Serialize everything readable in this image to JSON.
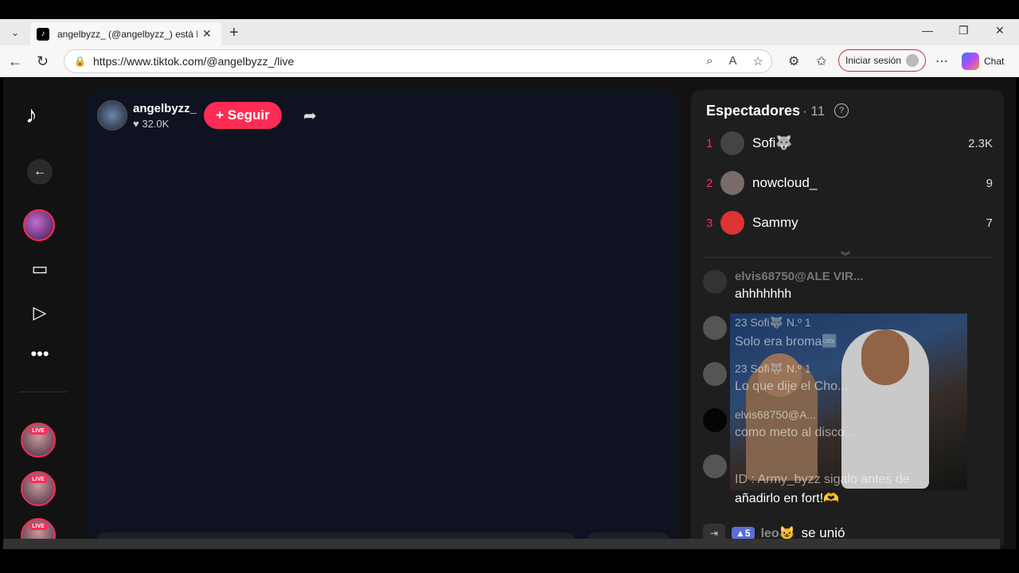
{
  "browser": {
    "tab_title": "angelbyzz_ (@angelbyzz_) está LIVE",
    "url": "https://www.tiktok.com/@angelbyzz_/live",
    "signin_label": "Iniciar sesión",
    "chat_label": "Chat"
  },
  "stream": {
    "streamer_name": "angelbyzz_",
    "likes": "32.0K",
    "follow_label": "+ Seguir"
  },
  "nav": {
    "live_badge": "LIVE"
  },
  "viewers": {
    "title": "Espectadores",
    "count": "· 11",
    "list": [
      {
        "rank": "1",
        "name": "Sofi🐺",
        "score": "2.3K"
      },
      {
        "rank": "2",
        "name": "nowcloud_",
        "score": "9"
      },
      {
        "rank": "3",
        "name": "Sammy",
        "score": "7"
      }
    ]
  },
  "chat": {
    "msg1_user": "elvis68750@ALE VIR...",
    "msg1_text": "ahhhhhhh",
    "line_a": "23   Sofi🐺  N.º 1",
    "line_b": "Solo era broma🆒",
    "line_c": "23   Sofi🐺  N.º 1",
    "line_d": "Lo que dije el Cho...",
    "line_e": "elvis68750@A...",
    "line_f": "como meto al disco...",
    "line_g": "ID : Army_byzz sigalo antes de",
    "msg_last": "añadirlo en fort!🫶",
    "join_level": "5",
    "join_name": "leo😺",
    "join_text": "se unió"
  }
}
